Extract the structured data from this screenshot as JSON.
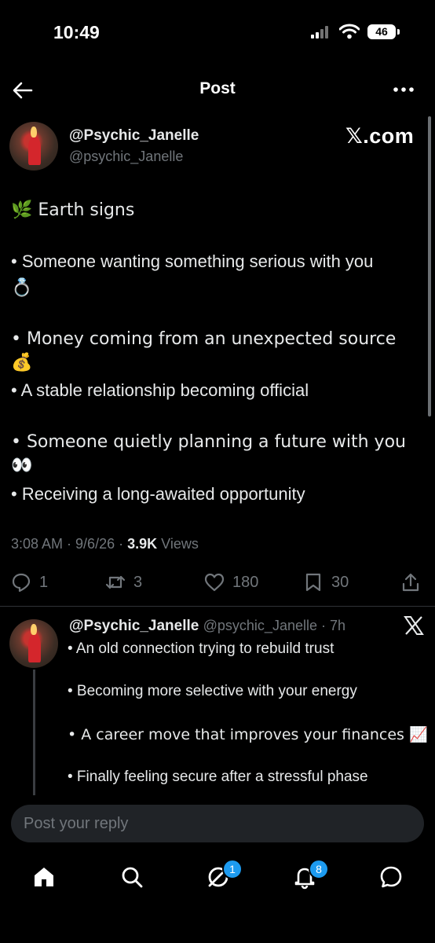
{
  "status_bar": {
    "time": "10:49",
    "battery": "46"
  },
  "header": {
    "title": "Post"
  },
  "post": {
    "display_name": "@Psychic_Janelle",
    "handle": "@psychic_Janelle",
    "brand": "𝕏.com",
    "lines": [
      "🌿 Earth signs",
      "• Someone wanting something serious with you",
      "💍",
      "• Money coming from an unexpected source 💰",
      "• A stable relationship becoming official",
      "• Someone quietly planning a future with you 👀",
      "• Receiving a long-awaited opportunity"
    ],
    "time": "3:08 AM",
    "date": "9/6/26",
    "views_count": "3.9K",
    "views_label": "Views",
    "replies": "1",
    "reposts": "3",
    "likes": "180",
    "bookmarks": "30"
  },
  "reply": {
    "display_name": "@Psychic_Janelle",
    "handle": "@psychic_Janelle",
    "age": "7h",
    "lines": [
      "• An old connection trying to rebuild trust",
      "• Becoming more selective with your energy",
      "• A career move that improves your finances 📈",
      "• Finally feeling secure after a stressful phase"
    ]
  },
  "composer": {
    "placeholder": "Post your reply"
  },
  "bottom_nav": {
    "items": [
      "home-icon",
      "search-icon",
      "grok-icon",
      "notifications-icon",
      "messages-icon"
    ],
    "grok_badge": "1",
    "notifications_badge": "8"
  },
  "colors": {
    "background": "#000000",
    "text": "#e7e9ea",
    "muted": "#71767b",
    "accent": "#1d9bf0"
  }
}
